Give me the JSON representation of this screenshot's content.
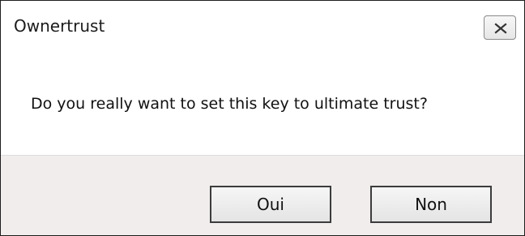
{
  "dialog": {
    "title": "Ownertrust",
    "close_icon": "close-icon",
    "message": "Do you really want to set this key to ultimate trust?",
    "buttons": {
      "yes_label": "Oui",
      "no_label": "Non"
    }
  }
}
